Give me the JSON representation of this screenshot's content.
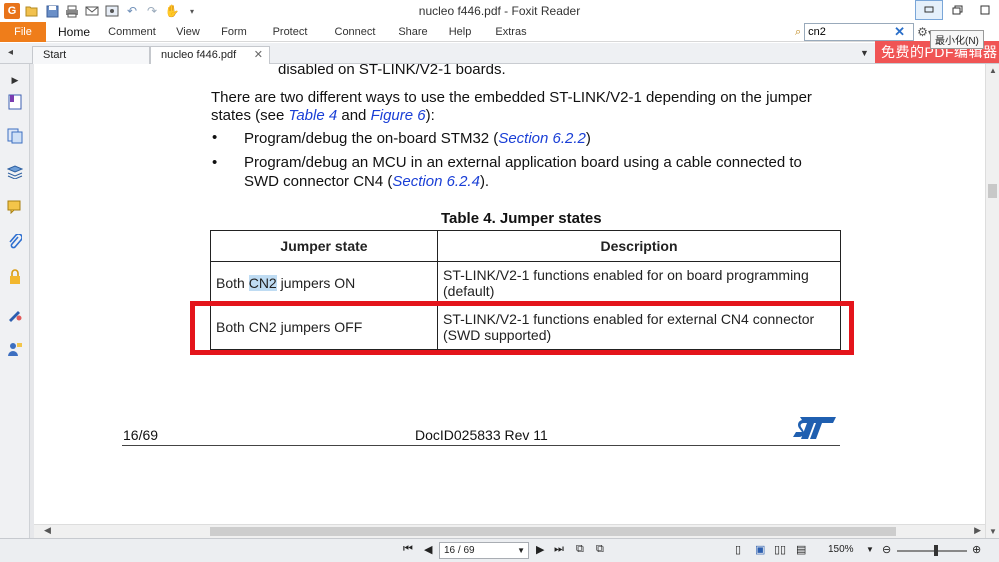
{
  "window": {
    "title": "nucleo f446.pdf - Foxit Reader",
    "minimize_tooltip": "最小化(N)"
  },
  "quick_access": {
    "icons": [
      "app-logo-icon",
      "open-icon",
      "save-icon",
      "print-icon",
      "email-icon",
      "screenshot-icon",
      "undo-icon",
      "redo-icon",
      "hand-tool-icon",
      "customize-icon"
    ]
  },
  "ribbon": {
    "tabs": [
      "File",
      "Home",
      "Comment",
      "View",
      "Form",
      "Protect",
      "Connect",
      "Share",
      "Help",
      "Extras"
    ],
    "search_value": "cn2"
  },
  "doc_tabs": {
    "start_label": "Start",
    "active_label": "nucleo f446.pdf"
  },
  "promo": {
    "text": "免费的PDF编辑器"
  },
  "document": {
    "line_cut": "disabled on ST-LINK/V2-1 boards.",
    "para1_line1": "There are two different ways to use the embedded ST-LINK/V2-1 depending on the jumper",
    "para1_line2_a": "states (see ",
    "para1_line2_link1": "Table 4",
    "para1_line2_b": " and ",
    "para1_line2_link2": "Figure 6",
    "para1_line2_c": "):",
    "bullet1_a": "Program/debug the on-board STM32 (",
    "bullet1_link": "Section 6.2.2",
    "bullet1_b": ")",
    "bullet2_line1": "Program/debug an MCU in an external application board using a cable connected to",
    "bullet2_line2_a": "SWD connector CN4 (",
    "bullet2_line2_link": "Section 6.2.4",
    "bullet2_line2_b": ").",
    "table_caption": "Table 4. Jumper states",
    "table": {
      "headers": [
        "Jumper state",
        "Description"
      ],
      "rows": [
        {
          "state_a": "Both ",
          "state_hl": "CN2",
          "state_b": " jumpers ON",
          "desc_line1": "ST-LINK/V2-1 functions enabled for on board programming",
          "desc_line2": "(default)"
        },
        {
          "state": "Both CN2 jumpers OFF",
          "desc_line1": "ST-LINK/V2-1 functions enabled for external CN4 connector",
          "desc_line2": "(SWD supported)"
        }
      ]
    },
    "footer_page": "16/69",
    "footer_docid": "DocID025833 Rev 11"
  },
  "statusbar": {
    "page_value": "16 / 69",
    "zoom": "150%"
  },
  "colors": {
    "file_tab": "#ef7d1a",
    "highlight_box": "#e4141b",
    "link": "#1a3fd6",
    "promo": "#f05454"
  }
}
